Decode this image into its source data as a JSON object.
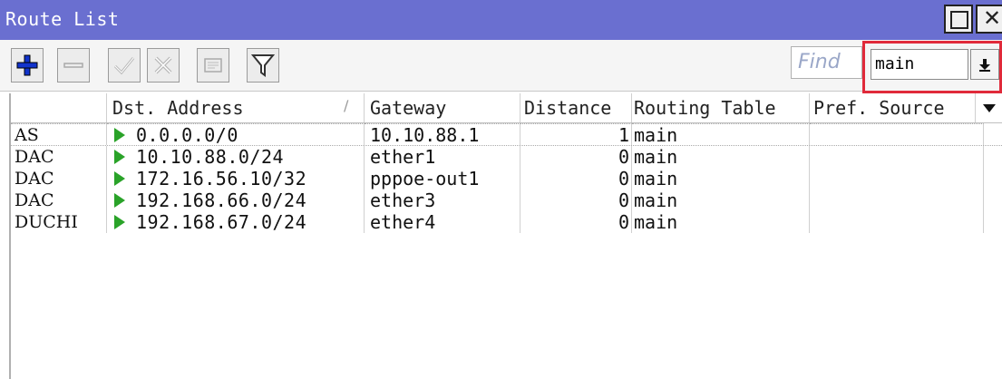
{
  "window": {
    "title": "Route List"
  },
  "toolbar": {
    "add_icon": "plus-icon",
    "remove_icon": "minus-icon",
    "enable_icon": "check-icon",
    "disable_icon": "x-icon",
    "comment_icon": "note-icon",
    "filter_icon": "funnel-icon",
    "find_label": "Find",
    "table_filter_value": "main"
  },
  "table": {
    "columns": [
      "",
      "Dst. Address",
      "Gateway",
      "Distance",
      "Routing Table",
      "Pref. Source"
    ],
    "rows": [
      {
        "flags": "AS",
        "dst": "0.0.0.0/0",
        "gateway": "10.10.88.1",
        "distance": "1",
        "routing_table": "main",
        "pref_source": ""
      },
      {
        "flags": "DAC",
        "dst": "10.10.88.0/24",
        "gateway": "ether1",
        "distance": "0",
        "routing_table": "main",
        "pref_source": ""
      },
      {
        "flags": "DAC",
        "dst": "172.16.56.10/32",
        "gateway": "pppoe-out1",
        "distance": "0",
        "routing_table": "main",
        "pref_source": ""
      },
      {
        "flags": "DAC",
        "dst": "192.168.66.0/24",
        "gateway": "ether3",
        "distance": "0",
        "routing_table": "main",
        "pref_source": ""
      },
      {
        "flags": "DUCHI",
        "dst": "192.168.67.0/24",
        "gateway": "ether4",
        "distance": "0",
        "routing_table": "main",
        "pref_source": ""
      }
    ]
  },
  "colors": {
    "titlebar": "#6a6fd0",
    "active_arrow": "#2aa329",
    "highlight": "#e02a3a",
    "add_icon": "#1133cc"
  }
}
